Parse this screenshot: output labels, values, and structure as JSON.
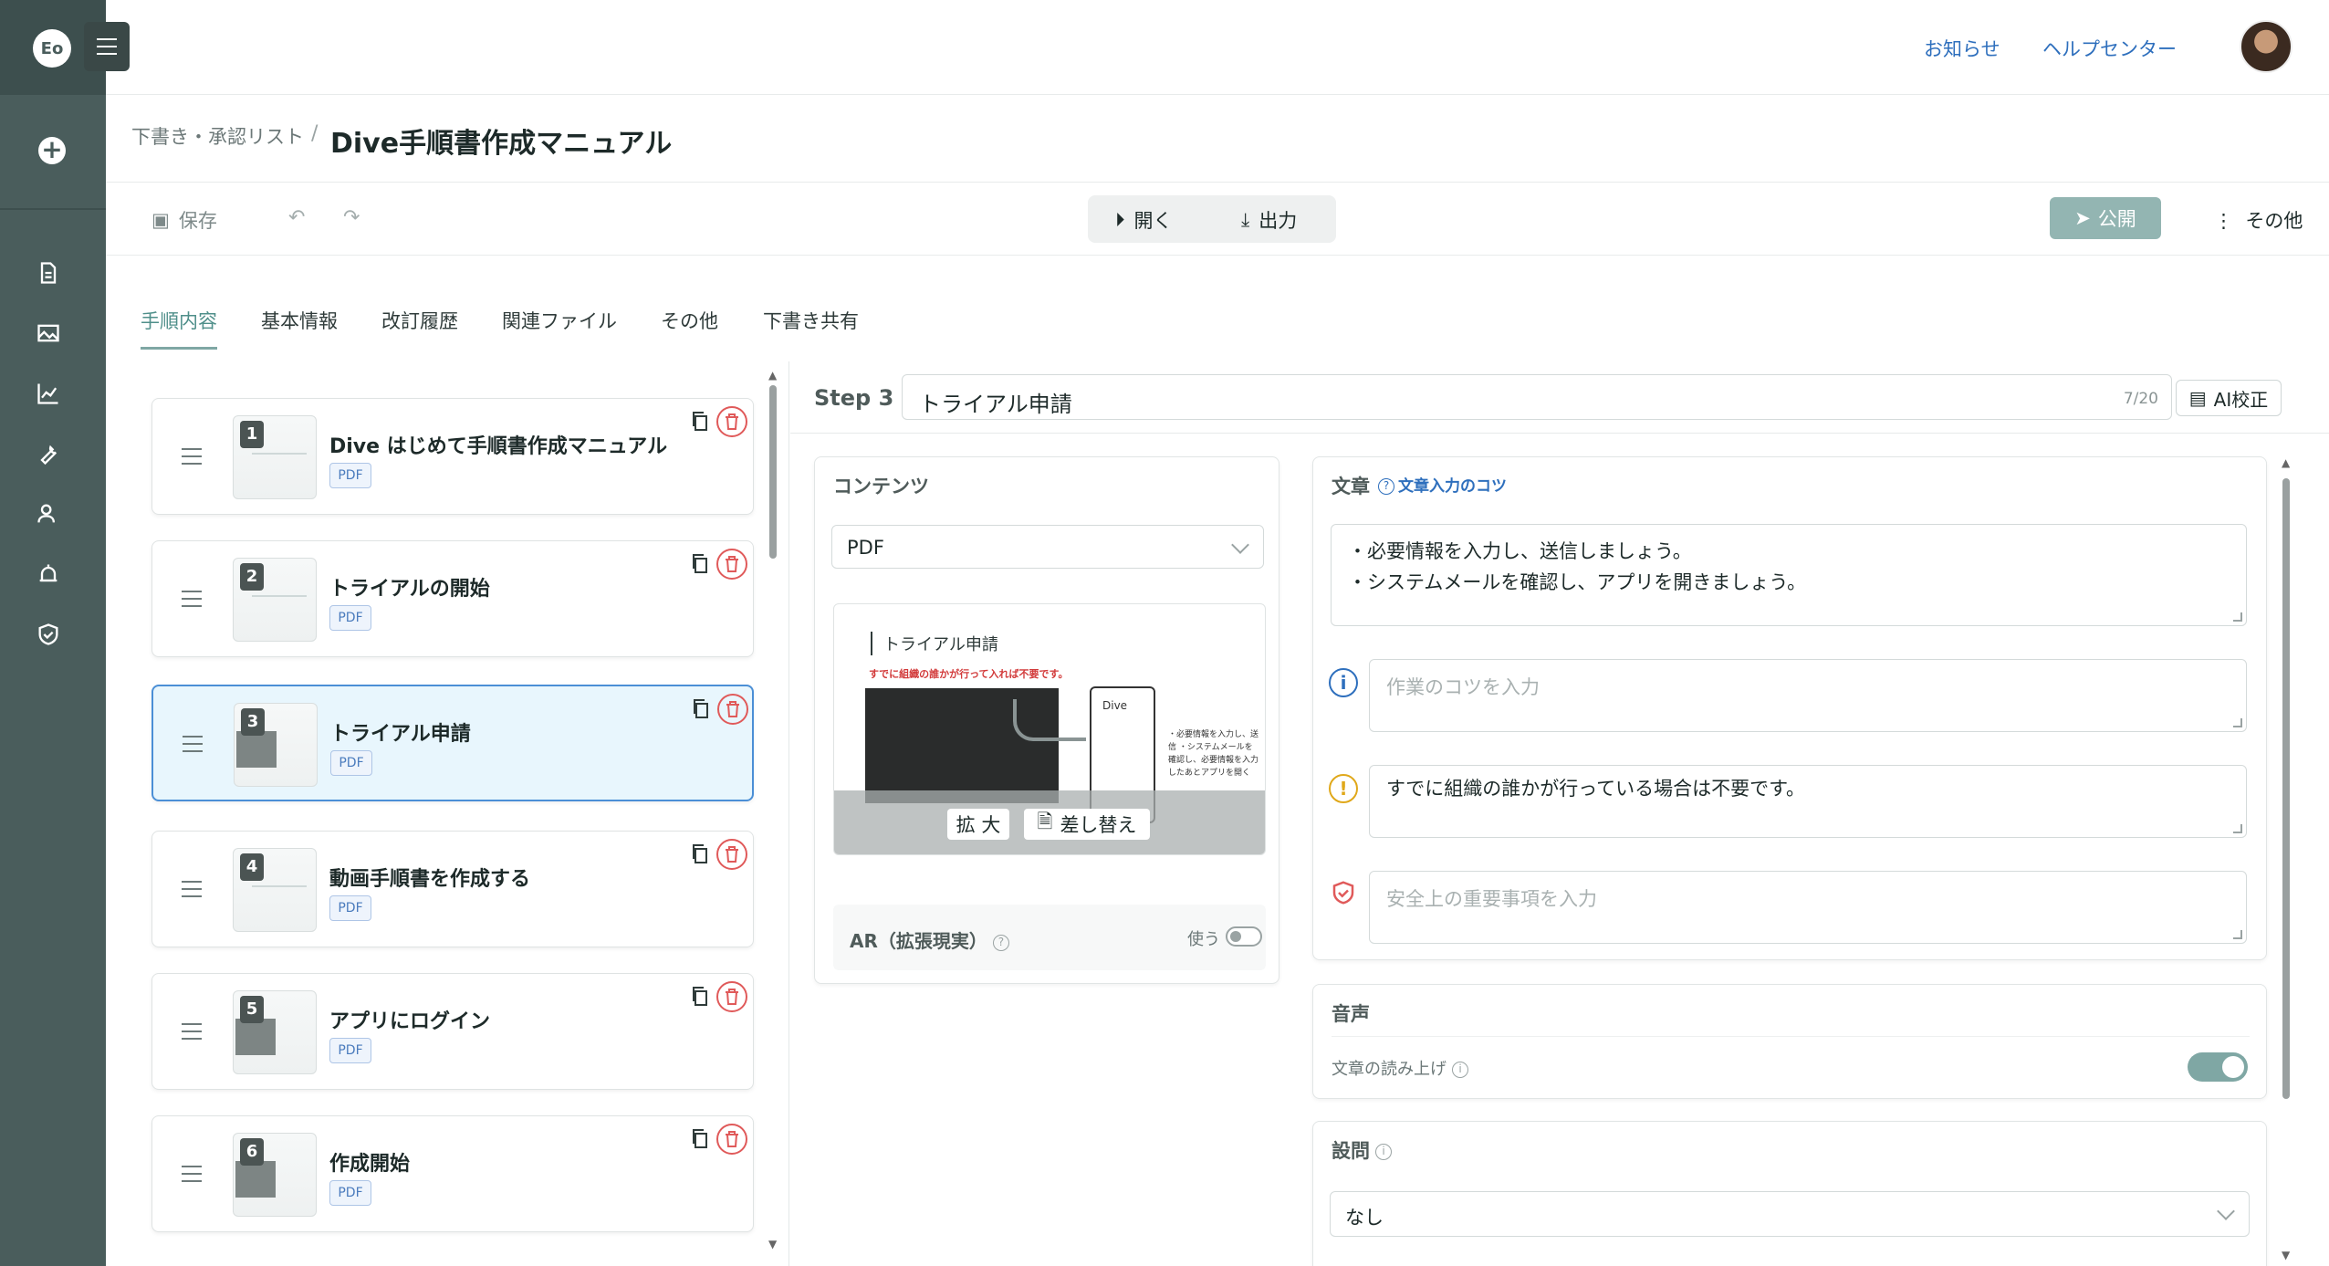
{
  "header": {
    "notice_label": "お知らせ",
    "help_label": "ヘルプセンター"
  },
  "breadcrumb": {
    "parent": "下書き・承認リスト",
    "separator": "/",
    "title": "Dive手順書作成マニュアル"
  },
  "toolbar": {
    "save_label": "保存",
    "open_label": "開く",
    "export_label": "出力",
    "publish_label": "公開",
    "other_label": "その他"
  },
  "tabs": [
    {
      "label": "手順内容",
      "active": true
    },
    {
      "label": "基本情報"
    },
    {
      "label": "改訂履歴"
    },
    {
      "label": "関連ファイル"
    },
    {
      "label": "その他"
    },
    {
      "label": "下書き共有"
    }
  ],
  "steps": [
    {
      "num": "1",
      "title": "Dive はじめて手順書作成マニュアル",
      "badge": "PDF"
    },
    {
      "num": "2",
      "title": "トライアルの開始",
      "badge": "PDF"
    },
    {
      "num": "3",
      "title": "トライアル申請",
      "badge": "PDF",
      "selected": true
    },
    {
      "num": "4",
      "title": "動画手順書を作成する",
      "badge": "PDF"
    },
    {
      "num": "5",
      "title": "アプリにログイン",
      "badge": "PDF"
    },
    {
      "num": "6",
      "title": "作成開始",
      "badge": "PDF"
    }
  ],
  "editor": {
    "step_label": "Step 3",
    "step_title": "トライアル申請",
    "char_count": "7/20",
    "ai_button": "AI校正"
  },
  "content_panel": {
    "heading": "コンテンツ",
    "type_value": "PDF",
    "preview_title": "トライアル申請",
    "preview_note": "すでに組織の誰かが行って入れば不要です。",
    "preview_dive": "Dive",
    "preview_bullets": "・必要情報を入力し、送信\n・システムメールを確認し、必要情報を入力したあとアプリを開く",
    "zoom_label": "拡 大",
    "replace_label": "差し替え",
    "ar_label": "AR（拡張現実）",
    "ar_use_label": "使う",
    "ar_enabled": false
  },
  "text_panel": {
    "heading": "文章",
    "tips_link": "文章入力のコツ",
    "body": "・必要情報を入力し、送信しましょう。\n・システムメールを確認し、アプリを開きましょう。",
    "tip_placeholder": "作業のコツを入力",
    "warning_text": "すでに組織の誰かが行っている場合は不要です。",
    "safety_placeholder": "安全上の重要事項を入力"
  },
  "audio_panel": {
    "heading": "音声",
    "read_aloud_label": "文章の読み上げ",
    "read_aloud_enabled": true
  },
  "question_panel": {
    "heading": "設問",
    "value": "なし"
  },
  "colors": {
    "accent": "#7fa7a4",
    "rail": "#4a5d5c",
    "link": "#2e6fbd",
    "danger": "#e05a5a",
    "selected_border": "#4b8fd6",
    "warning": "#e0a81a",
    "info": "#2e6fbd"
  }
}
